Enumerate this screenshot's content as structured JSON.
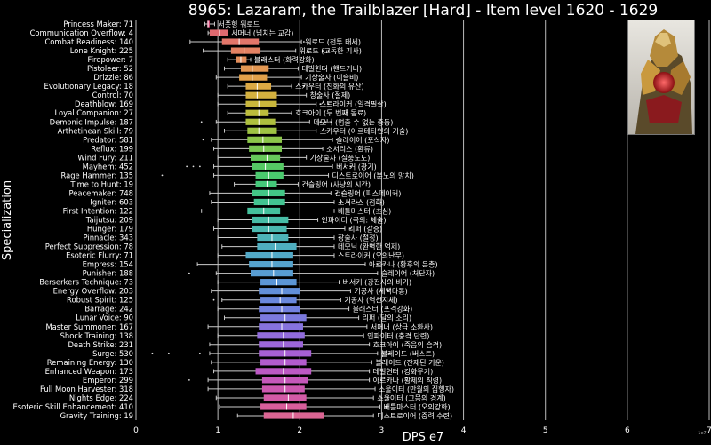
{
  "chart_data": {
    "type": "boxplot",
    "title": "8965: Lazaram, the Trailblazer [Hard] - Item level 1620 - 1629",
    "xlabel": "DPS e7",
    "ylabel": "Specialization",
    "xlim": [
      0,
      7
    ],
    "xticks": [
      "0",
      "1",
      "2",
      "3",
      "4",
      "5",
      "6",
      "7"
    ],
    "scale_note": "1e7",
    "grid": "vertical",
    "categories": [
      {
        "label": "Princess Maker: 71",
        "ko": "서폿형 워로드",
        "min": 0.84,
        "q1": 0.87,
        "med": 0.88,
        "q3": 0.9,
        "max": 0.96,
        "color": "#dc4a7c",
        "outliers": [
          1.02
        ]
      },
      {
        "label": "Communication Overflow: 4",
        "ko": "서머너 (넘치는 교감)",
        "min": 0.88,
        "q1": 0.9,
        "med": 1.02,
        "q3": 1.12,
        "max": 1.12,
        "color": "#e06a70",
        "outliers": []
      },
      {
        "label": "Combat Readiness: 140",
        "ko": "워로드 (전투 태세)",
        "min": 0.66,
        "q1": 1.05,
        "med": 1.26,
        "q3": 1.5,
        "max": 2.02,
        "color": "#e3766a",
        "outliers": [
          2.05
        ]
      },
      {
        "label": "Lone Knight: 225",
        "ko": "워로드 (고독한 기사)",
        "min": 0.82,
        "q1": 1.16,
        "med": 1.32,
        "q3": 1.52,
        "max": 1.95,
        "color": "#e48263",
        "outliers": [
          2.1,
          2.2,
          2.28,
          2.35
        ]
      },
      {
        "label": "Firepower: 7",
        "ko": "블래스터 (화력강화)",
        "min": 1.12,
        "q1": 1.22,
        "med": 1.28,
        "q3": 1.35,
        "max": 1.4,
        "color": "#e38d5a",
        "outliers": []
      },
      {
        "label": "Pistoleer: 52",
        "ko": "데빌헌터 (핸드거너)",
        "min": 1.08,
        "q1": 1.28,
        "med": 1.42,
        "q3": 1.62,
        "max": 1.98,
        "color": "#e39752",
        "outliers": [
          2.2,
          2.32
        ]
      },
      {
        "label": "Drizzle: 86",
        "ko": "기상술사 (이슬비)",
        "min": 0.98,
        "q1": 1.26,
        "med": 1.42,
        "q3": 1.6,
        "max": 2.02,
        "color": "#e2a04a",
        "outliers": []
      },
      {
        "label": "Evolutionary Legacy: 18",
        "ko": "스카우터 (진화의 유산)",
        "min": 1.12,
        "q1": 1.34,
        "med": 1.48,
        "q3": 1.65,
        "max": 1.9,
        "color": "#dca944",
        "outliers": [
          2.05
        ]
      },
      {
        "label": "Control: 70",
        "ko": "창술사 (절제)",
        "min": 1.0,
        "q1": 1.34,
        "med": 1.48,
        "q3": 1.72,
        "max": 2.08,
        "color": "#d4b13f",
        "outliers": []
      },
      {
        "label": "Deathblow: 169",
        "ko": "스트라이커 (일격필살)",
        "min": 1.0,
        "q1": 1.34,
        "med": 1.5,
        "q3": 1.72,
        "max": 2.2,
        "color": "#c9b73c",
        "outliers": [
          2.25,
          2.35
        ]
      },
      {
        "label": "Loyal Companion: 27",
        "ko": "호크아이 (두 번째 동료)",
        "min": 1.12,
        "q1": 1.34,
        "med": 1.5,
        "q3": 1.62,
        "max": 1.9,
        "color": "#bcbc3c",
        "outliers": []
      },
      {
        "label": "Demonic Impulse: 187",
        "ko": "데모닉 (멈출 수 없는 충동)",
        "min": 0.98,
        "q1": 1.34,
        "med": 1.5,
        "q3": 1.7,
        "max": 2.12,
        "color": "#aec03e",
        "outliers": [
          0.8,
          2.25,
          2.32,
          2.38
        ]
      },
      {
        "label": "Arthetinean Skill: 79",
        "ko": "스카우터 (아르테타인의 기술)",
        "min": 1.08,
        "q1": 1.36,
        "med": 1.5,
        "q3": 1.72,
        "max": 2.2,
        "color": "#9ec343",
        "outliers": [
          2.32
        ]
      },
      {
        "label": "Predator: 581",
        "ko": "슬레이어 (포식자)",
        "min": 0.92,
        "q1": 1.36,
        "med": 1.55,
        "q3": 1.78,
        "max": 2.4,
        "color": "#8cc64a",
        "outliers": [
          0.82,
          2.45
        ]
      },
      {
        "label": "Reflux: 199",
        "ko": "소서리스 (환류)",
        "min": 0.95,
        "q1": 1.38,
        "med": 1.56,
        "q3": 1.78,
        "max": 2.28,
        "color": "#7ac852",
        "outliers": []
      },
      {
        "label": "Wind Fury: 211",
        "ko": "기상술사 (질풍노도)",
        "min": 1.0,
        "q1": 1.4,
        "med": 1.6,
        "q3": 1.76,
        "max": 2.08,
        "color": "#66c95b",
        "outliers": []
      },
      {
        "label": "Mayhem: 452",
        "ko": "버서커 (광기)",
        "min": 0.95,
        "q1": 1.42,
        "med": 1.58,
        "q3": 1.8,
        "max": 2.4,
        "color": "#55c964",
        "outliers": [
          0.62,
          0.7,
          0.78,
          2.48,
          2.55,
          2.62
        ]
      },
      {
        "label": "Rage Hammer: 135",
        "ko": "디스트로이어 (분노의 망치)",
        "min": 0.95,
        "q1": 1.46,
        "med": 1.62,
        "q3": 1.8,
        "max": 2.35,
        "color": "#4ac96e",
        "outliers": [
          0.32
        ]
      },
      {
        "label": "Time to Hunt: 19",
        "ko": "건슬링어 (사냥의 시간)",
        "min": 1.2,
        "q1": 1.46,
        "med": 1.6,
        "q3": 1.72,
        "max": 1.98,
        "color": "#44c87a",
        "outliers": []
      },
      {
        "label": "Peacemaker: 748",
        "ko": "건슬링어 (피스메이커)",
        "min": 0.9,
        "q1": 1.42,
        "med": 1.62,
        "q3": 1.82,
        "max": 2.38,
        "color": "#42c686",
        "outliers": [
          2.45,
          2.52
        ]
      },
      {
        "label": "Igniter: 603",
        "ko": "소서리스 (점화)",
        "min": 0.92,
        "q1": 1.44,
        "med": 1.62,
        "q3": 1.82,
        "max": 2.42,
        "color": "#42c391",
        "outliers": [
          2.5,
          2.6,
          2.7
        ]
      },
      {
        "label": "First Intention: 122",
        "ko": "배틀마스터 (초심)",
        "min": 0.8,
        "q1": 1.36,
        "med": 1.56,
        "q3": 1.76,
        "max": 2.42,
        "color": "#44c09c",
        "outliers": []
      },
      {
        "label": "Taijutsu: 209",
        "ko": "인파이터 (극의: 체술)",
        "min": 1.0,
        "q1": 1.42,
        "med": 1.62,
        "q3": 1.86,
        "max": 2.22,
        "color": "#47bca6",
        "outliers": []
      },
      {
        "label": "Hunger: 179",
        "ko": "리퍼 (갈증)",
        "min": 0.95,
        "q1": 1.42,
        "med": 1.62,
        "q3": 1.84,
        "max": 2.55,
        "color": "#4ab8af",
        "outliers": [
          2.62
        ]
      },
      {
        "label": "Pinnacle: 343",
        "ko": "창술사 (절정)",
        "min": 1.0,
        "q1": 1.48,
        "med": 1.66,
        "q3": 1.86,
        "max": 2.42,
        "color": "#4db3b8",
        "outliers": [
          2.48
        ]
      },
      {
        "label": "Perfect Suppression: 78",
        "ko": "데모닉 (완벽한 억제)",
        "min": 1.05,
        "q1": 1.48,
        "med": 1.7,
        "q3": 1.96,
        "max": 2.42,
        "color": "#4faec0",
        "outliers": []
      },
      {
        "label": "Esoteric Flurry: 71",
        "ko": "스트라이커 (오의난무)",
        "min": 1.0,
        "q1": 1.34,
        "med": 1.66,
        "q3": 1.92,
        "max": 2.42,
        "color": "#52a9c7",
        "outliers": []
      },
      {
        "label": "Empress: 154",
        "ko": "아르카나 (황후의 은총)",
        "min": 0.75,
        "q1": 1.38,
        "med": 1.66,
        "q3": 1.92,
        "max": 2.8,
        "color": "#55a3cd",
        "outliers": [
          2.95,
          3.0
        ]
      },
      {
        "label": "Punisher: 188",
        "ko": "슬레이어 (처단자)",
        "min": 0.98,
        "q1": 1.4,
        "med": 1.68,
        "q3": 1.92,
        "max": 2.95,
        "color": "#589dd2",
        "outliers": [
          0.65
        ]
      },
      {
        "label": "Berserkers Technique: 73",
        "ko": "버서커 (광전사의 비기)",
        "min": 1.0,
        "q1": 1.52,
        "med": 1.72,
        "q3": 1.96,
        "max": 2.48,
        "color": "#5c96d6",
        "outliers": []
      },
      {
        "label": "Energy Overflow: 203",
        "ko": "기공사 (세맥타통)",
        "min": 0.92,
        "q1": 1.5,
        "med": 1.78,
        "q3": 2.0,
        "max": 2.62,
        "color": "#628fd9",
        "outliers": [
          3.0,
          3.08
        ]
      },
      {
        "label": "Robust Spirit: 125",
        "ko": "기공사 (역천지체)",
        "min": 1.05,
        "q1": 1.52,
        "med": 1.76,
        "q3": 1.96,
        "max": 2.5,
        "color": "#6a88dc",
        "outliers": [
          0.95
        ]
      },
      {
        "label": "Barrage: 242",
        "ko": "블래스터 (포격강화)",
        "min": 1.0,
        "q1": 1.5,
        "med": 1.78,
        "q3": 2.0,
        "max": 2.6,
        "color": "#7281de",
        "outliers": []
      },
      {
        "label": "Lunar Voice: 90",
        "ko": "리퍼 (달의 소리)",
        "min": 1.08,
        "q1": 1.52,
        "med": 1.82,
        "q3": 2.08,
        "max": 2.72,
        "color": "#7c7ade",
        "outliers": []
      },
      {
        "label": "Master Summoner: 167",
        "ko": "서머너 (상급 소환사)",
        "min": 0.88,
        "q1": 1.5,
        "med": 1.78,
        "q3": 2.04,
        "max": 2.82,
        "color": "#8673de",
        "outliers": []
      },
      {
        "label": "Shock Training: 138",
        "ko": "인파이터 (충격 단련)",
        "min": 1.0,
        "q1": 1.48,
        "med": 1.8,
        "q3": 2.06,
        "max": 2.78,
        "color": "#916cdc",
        "outliers": []
      },
      {
        "label": "Death Strike: 231",
        "ko": "호크아이 (죽음의 습격)",
        "min": 0.9,
        "q1": 1.5,
        "med": 1.8,
        "q3": 2.04,
        "max": 2.85,
        "color": "#9c66d9",
        "outliers": []
      },
      {
        "label": "Surge: 530",
        "ko": "블레이드 (버스트)",
        "min": 0.9,
        "q1": 1.5,
        "med": 1.82,
        "q3": 2.14,
        "max": 2.95,
        "color": "#a760d4",
        "outliers": [
          0.2,
          0.4,
          0.78,
          3.02,
          3.1
        ]
      },
      {
        "label": "Remaining Energy: 130",
        "ko": "블레이드 (잔재된 기운)",
        "min": 0.92,
        "q1": 1.52,
        "med": 1.82,
        "q3": 2.08,
        "max": 2.88,
        "color": "#b25ccd",
        "outliers": [
          3.0
        ]
      },
      {
        "label": "Enhanced Weapon: 173",
        "ko": "데빌헌터 (강화무기)",
        "min": 0.95,
        "q1": 1.46,
        "med": 1.8,
        "q3": 2.14,
        "max": 2.85,
        "color": "#bc59c4",
        "outliers": []
      },
      {
        "label": "Emperor: 299",
        "ko": "아르카나 (황제의 칙령)",
        "min": 0.88,
        "q1": 1.54,
        "med": 1.82,
        "q3": 2.1,
        "max": 2.85,
        "color": "#c558ba",
        "outliers": [
          0.65,
          3.0
        ]
      },
      {
        "label": "Full Moon Harvester: 318",
        "ko": "소울이터 (만월의 집행자)",
        "min": 0.88,
        "q1": 1.54,
        "med": 1.82,
        "q3": 2.06,
        "max": 2.92,
        "color": "#cd58b0",
        "outliers": []
      },
      {
        "label": "Nights Edge: 224",
        "ko": "소울이터 (그믐의 경계)",
        "min": 0.98,
        "q1": 1.56,
        "med": 1.86,
        "q3": 2.08,
        "max": 2.9,
        "color": "#d35aa6",
        "outliers": [
          3.0,
          3.08
        ]
      },
      {
        "label": "Esoteric Skill Enhancement: 410",
        "ko": "배틀마스터 (오의강화)",
        "min": 1.02,
        "q1": 1.52,
        "med": 1.84,
        "q3": 2.08,
        "max": 2.98,
        "color": "#d85e9c",
        "outliers": [
          3.05
        ]
      },
      {
        "label": "Gravity Training: 19",
        "ko": "디스트로이어 (중력 수련)",
        "min": 1.24,
        "q1": 1.56,
        "med": 1.92,
        "q3": 2.3,
        "max": 2.9,
        "color": "#db6593",
        "outliers": []
      }
    ]
  }
}
